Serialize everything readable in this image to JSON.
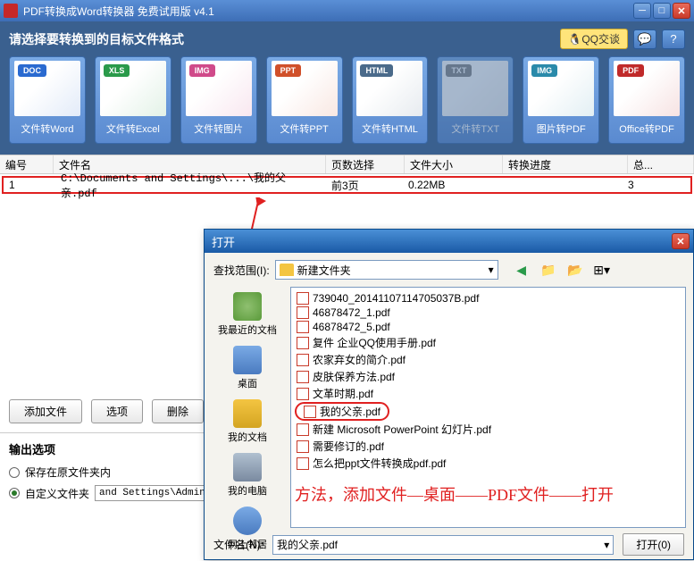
{
  "window": {
    "title": "PDF转换成Word转换器 免费试用版 v4.1"
  },
  "toolbar": {
    "prompt": "请选择要转换到的目标文件格式",
    "qq_label": "🐧QQ交谈"
  },
  "tiles": [
    {
      "badge": "DOC",
      "label": "文件转Word",
      "color": "#2a6ad0"
    },
    {
      "badge": "XLS",
      "label": "文件转Excel",
      "color": "#2a9a4a"
    },
    {
      "badge": "IMG",
      "label": "文件转图片",
      "color": "#d04a8a"
    },
    {
      "badge": "PPT",
      "label": "文件转PPT",
      "color": "#d0502a"
    },
    {
      "badge": "HTML",
      "label": "文件转HTML",
      "color": "#4a6a8a"
    },
    {
      "badge": "TXT",
      "label": "文件转TXT",
      "color": "#8a8a8a"
    },
    {
      "badge": "IMG",
      "label": "图片转PDF",
      "color": "#2a8aaa"
    },
    {
      "badge": "PDF",
      "label": "Office转PDF",
      "color": "#c02a2a"
    }
  ],
  "grid": {
    "headers": {
      "num": "编号",
      "name": "文件名",
      "page": "页数选择",
      "size": "文件大小",
      "progress": "转换进度",
      "total": "总..."
    },
    "row": {
      "num": "1",
      "name": "C:\\Documents and Settings\\...\\我的父亲.pdf",
      "page": "前3页",
      "size": "0.22MB",
      "progress": "",
      "total": "3"
    }
  },
  "buttons": {
    "add": "添加文件",
    "options": "选项",
    "delete": "删除"
  },
  "output": {
    "title": "输出选项",
    "save_original": "保存在原文件夹内",
    "custom_folder": "自定义文件夹",
    "path": "and Settings\\Admin"
  },
  "dialog": {
    "title": "打开",
    "lookin_label": "查找范围(I):",
    "lookin_value": "新建文件夹",
    "sidebar": {
      "recent": "我最近的文档",
      "desktop": "桌面",
      "docs": "我的文档",
      "computer": "我的电脑",
      "network": "网上邻居"
    },
    "files": [
      "739040_20141107114705037B.pdf",
      "46878472_1.pdf",
      "46878472_5.pdf",
      "复件 企业QQ使用手册.pdf",
      "农家弃女的简介.pdf",
      "皮肤保养方法.pdf",
      "文革时期.pdf",
      "我的父亲.pdf",
      "新建 Microsoft PowerPoint 幻灯片.pdf",
      "需要修订的.pdf",
      "怎么把ppt文件转换成pdf.pdf"
    ],
    "annotation": "方法，添加文件—桌面——PDF文件——打开",
    "filename_label": "文件名(N):",
    "filename_value": "我的父亲.pdf",
    "open_btn": "打开(0)"
  }
}
